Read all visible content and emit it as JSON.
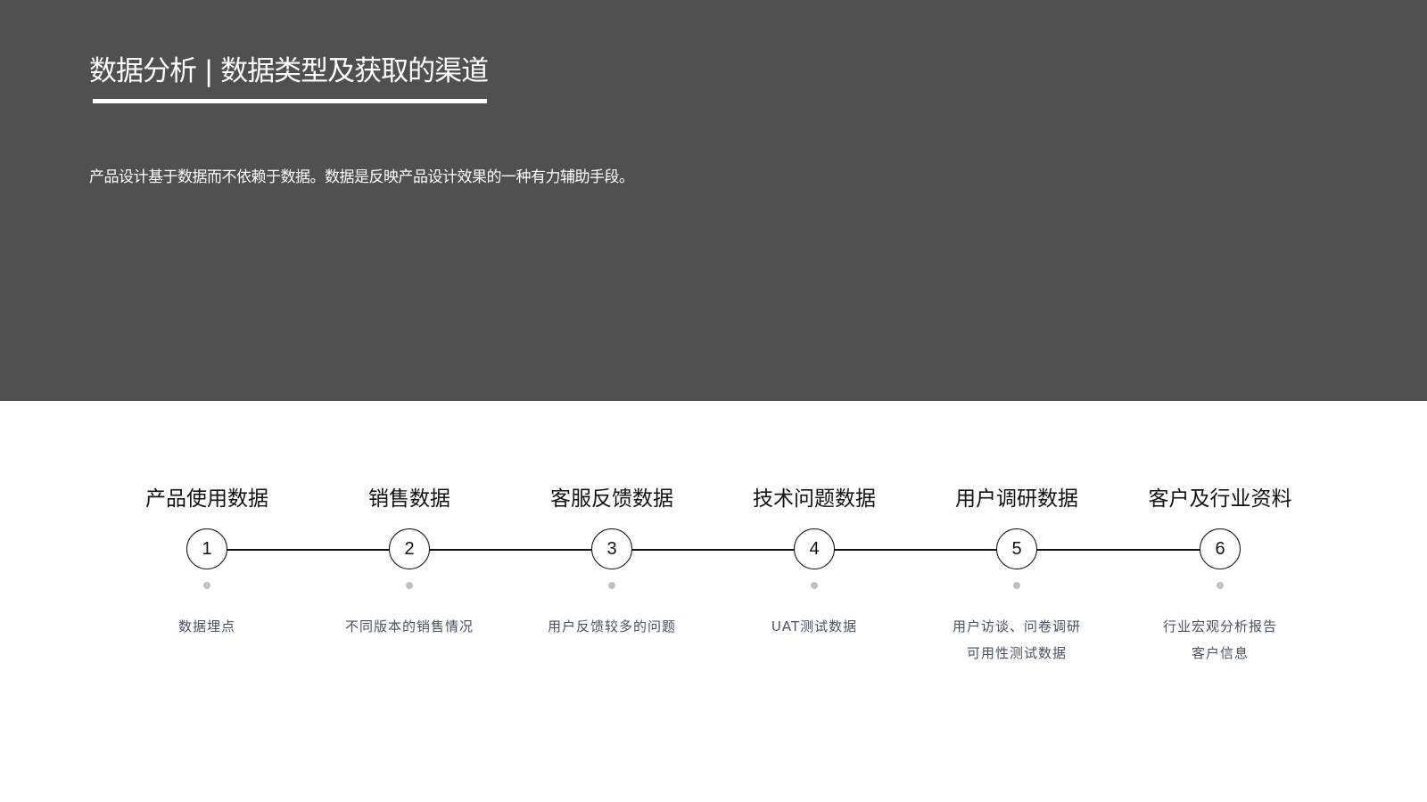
{
  "header": {
    "title": "数据分析 | 数据类型及获取的渠道",
    "subtitle": "产品设计基于数据而不依赖于数据。数据是反映产品设计效果的一种有力辅助手段。"
  },
  "steps": [
    {
      "number": "1",
      "title": "产品使用数据",
      "lines": [
        "数据埋点"
      ]
    },
    {
      "number": "2",
      "title": "销售数据",
      "lines": [
        "不同版本的销售情况"
      ]
    },
    {
      "number": "3",
      "title": "客服反馈数据",
      "lines": [
        "用户反馈较多的问题"
      ]
    },
    {
      "number": "4",
      "title": "技术问题数据",
      "lines": [
        "UAT测试数据"
      ]
    },
    {
      "number": "5",
      "title": "用户调研数据",
      "lines": [
        "用户访谈、问卷调研",
        "可用性测试数据"
      ]
    },
    {
      "number": "6",
      "title": "客户及行业资料",
      "lines": [
        "行业宏观分析报告",
        "客户信息"
      ]
    }
  ]
}
